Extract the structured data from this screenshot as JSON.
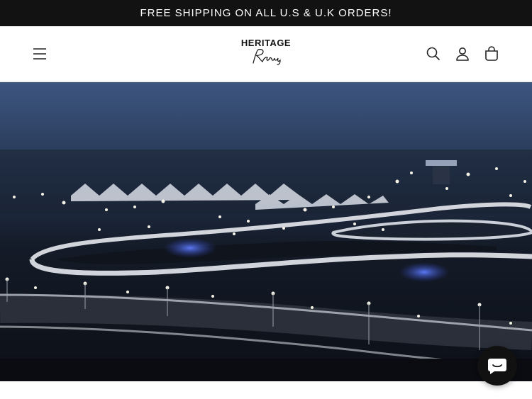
{
  "announcement": {
    "text": "FREE SHIPPING ON ALL U.S & U.K ORDERS!"
  },
  "header": {
    "logo": {
      "wordmark": "HERITAGE",
      "script": "Racing"
    },
    "icons": [
      "menu-icon",
      "search-icon",
      "account-icon",
      "cart-icon"
    ]
  },
  "hero": {
    "image": "night aerial view of illuminated race circuit"
  },
  "chat": {
    "icon": "chat-icon"
  },
  "colors": {
    "announcement_bg": "#121212",
    "header_bg": "#ffffff",
    "chat_bg": "#111111"
  }
}
